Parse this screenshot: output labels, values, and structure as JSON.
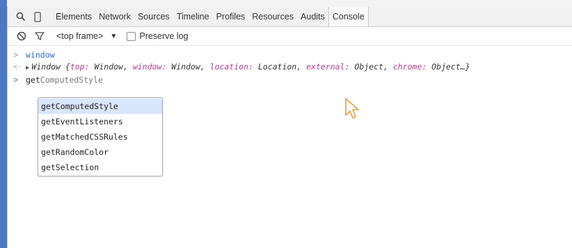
{
  "tabs": [
    "Elements",
    "Network",
    "Sources",
    "Timeline",
    "Profiles",
    "Resources",
    "Audits",
    "Console"
  ],
  "selected_tab": "Console",
  "filter": {
    "frame": "<top frame>",
    "preserve_log": "Preserve log",
    "preserve_log_checked": false
  },
  "console": {
    "line1": "window",
    "line2": {
      "prefix": "Window {",
      "k1": "top:",
      "v1": " Window, ",
      "k2": "window:",
      "v2": " Window, ",
      "k3": "location:",
      "v3": " Location, ",
      "k4": "external:",
      "v4": " Object, ",
      "k5": "chrome:",
      "v5": " Object…}"
    },
    "line3_typed": "get",
    "line3_rest": "ComputedStyle"
  },
  "autocomplete": [
    "getComputedStyle",
    "getEventListeners",
    "getMatchedCSSRules",
    "getRandomColor",
    "getSelection"
  ],
  "colors": {
    "accent_bar": "#4a78c2",
    "input_text": "#2f69d6",
    "object_key": "#b03d8f",
    "selected_suggestion": "#d8e6fb"
  }
}
